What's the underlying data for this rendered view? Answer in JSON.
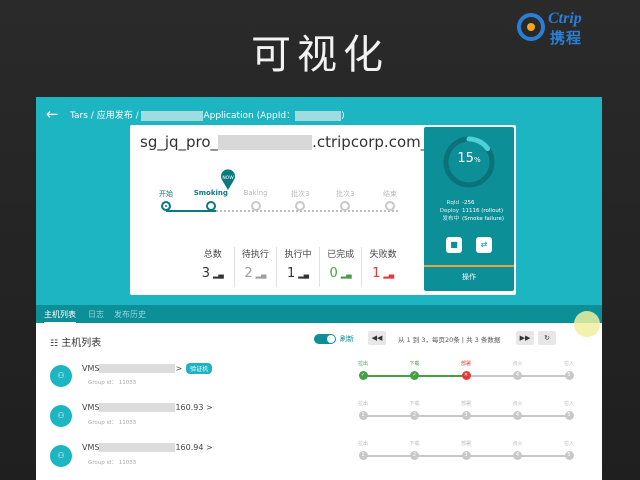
{
  "slide": {
    "title": "可视化"
  },
  "logo": {
    "en": "Ctrip",
    "cn": "携程"
  },
  "app": {
    "breadcrumb": {
      "root": "Tars",
      "section": "应用发布",
      "app_suffix": "Application (AppId：",
      "close": ")"
    },
    "card": {
      "app_name_prefix": "sg_jq_pro_",
      "app_name_suffix": ".ctripcorp.com_...",
      "pipeline": [
        {
          "label": "开始",
          "state": "done"
        },
        {
          "label": "Smoking",
          "state": "active"
        },
        {
          "label": "Baking",
          "state": "pending"
        },
        {
          "label": "批次3",
          "state": "pending"
        },
        {
          "label": "批次3",
          "state": "pending"
        },
        {
          "label": "结束",
          "state": "pending"
        }
      ],
      "now_tag": "NOW",
      "stats": [
        {
          "label": "总数",
          "value": "3",
          "color": "#333333"
        },
        {
          "label": "待执行",
          "value": "2",
          "color": "#9e9e9e"
        },
        {
          "label": "执行中",
          "value": "1",
          "color": "#333333"
        },
        {
          "label": "已完成",
          "value": "0",
          "color": "#43a047"
        },
        {
          "label": "失败数",
          "value": "1",
          "color": "#e53935"
        }
      ]
    },
    "progress": {
      "percent": 15,
      "percent_text": "15",
      "unit": "%",
      "rows": [
        {
          "key": "RqId",
          "value": "-256"
        },
        {
          "key": "Deploy",
          "value": "11116 (rollout)"
        },
        {
          "key": "发布中",
          "value": "(Smoke failure)"
        }
      ],
      "stop_icon": "■",
      "retry_icon": "⇄",
      "op_label": "操作"
    },
    "tabs": [
      {
        "label": "主机列表",
        "active": true
      },
      {
        "label": "日志",
        "active": false
      },
      {
        "label": "发布历史",
        "active": false
      }
    ],
    "host_list": {
      "title": "主机列表",
      "refresh_label": "刷新",
      "prev_icon": "◀◀",
      "page_text": "从 1 到 3，每页20条 | 共 3 条数据",
      "next_icon": "▶▶",
      "reload_icon": "↻",
      "step_labels": [
        "拉出",
        "下载",
        "部署",
        "点火",
        "拉入"
      ],
      "hosts": [
        {
          "name_prefix": "VMS",
          "name_suffix": ">",
          "badge": "验证机",
          "group": "Group id： 11033",
          "steps": [
            "ok",
            "ok",
            "fail",
            "pending",
            "pending"
          ]
        },
        {
          "name_prefix": "VMS",
          "name_suffix": "160.93 >",
          "badge": "",
          "group": "Group id： 11033",
          "steps": [
            "pending",
            "pending",
            "pending",
            "pending",
            "pending"
          ]
        },
        {
          "name_prefix": "VMS",
          "name_suffix": "160.94 >",
          "badge": "",
          "group": "Group id： 11033",
          "steps": [
            "pending",
            "pending",
            "pending",
            "pending",
            "pending"
          ]
        }
      ]
    }
  },
  "colors": {
    "teal": "#1cb5c1",
    "teal_dark": "#0d8f98",
    "ok": "#43a047",
    "fail": "#e53935"
  }
}
